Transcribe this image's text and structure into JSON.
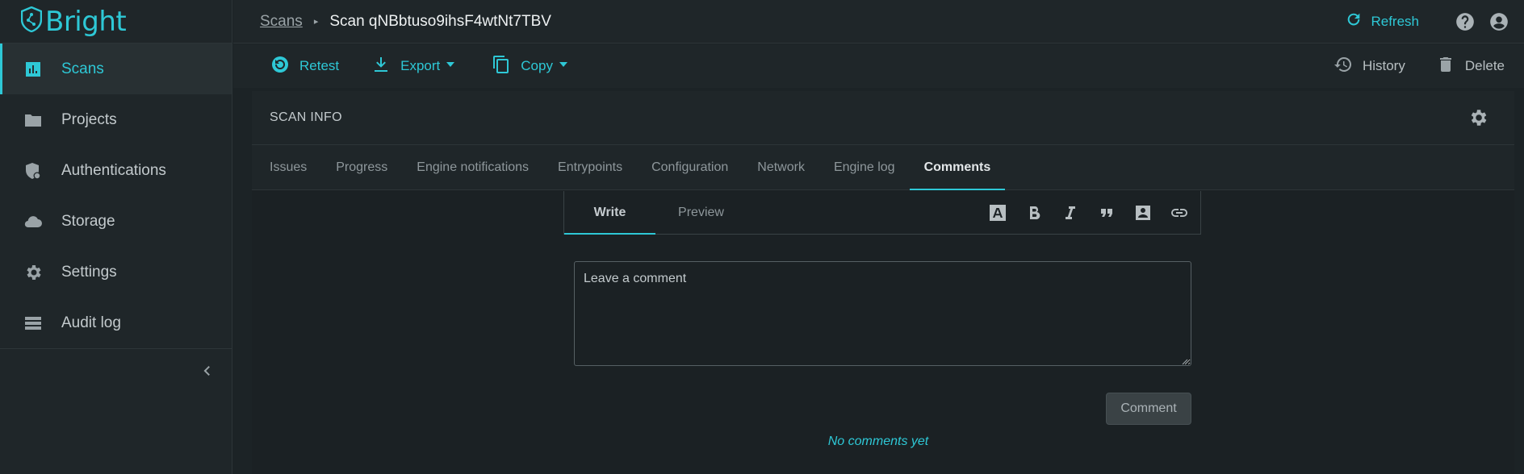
{
  "app": {
    "name": "Bright",
    "accent": "#2ec8d6"
  },
  "sidebar": {
    "items": [
      {
        "label": "Scans",
        "icon": "chart-icon",
        "active": true
      },
      {
        "label": "Projects",
        "icon": "folder-icon"
      },
      {
        "label": "Authentications",
        "icon": "shield-icon"
      },
      {
        "label": "Storage",
        "icon": "cloud-icon"
      },
      {
        "label": "Settings",
        "icon": "gear-icon"
      },
      {
        "label": "Audit log",
        "icon": "list-icon"
      }
    ],
    "collapse_icon": "chevron-left-icon"
  },
  "topbar": {
    "breadcrumb_root": "Scans",
    "breadcrumb_current": "Scan qNBbtuso9ihsF4wtNt7TBV",
    "refresh_label": "Refresh"
  },
  "toolbar": {
    "retest_label": "Retest",
    "export_label": "Export",
    "copy_label": "Copy",
    "history_label": "History",
    "delete_label": "Delete"
  },
  "card": {
    "title": "SCAN INFO",
    "tabs": [
      {
        "label": "Issues"
      },
      {
        "label": "Progress"
      },
      {
        "label": "Engine notifications"
      },
      {
        "label": "Entrypoints"
      },
      {
        "label": "Configuration"
      },
      {
        "label": "Network"
      },
      {
        "label": "Engine log"
      },
      {
        "label": "Comments",
        "active": true
      }
    ]
  },
  "editor": {
    "tabs": [
      {
        "label": "Write",
        "active": true
      },
      {
        "label": "Preview"
      }
    ],
    "format_icons": [
      "text-format-icon",
      "bold-icon",
      "italic-icon",
      "quote-icon",
      "mention-icon",
      "link-icon"
    ],
    "placeholder": "Leave a comment",
    "value": "",
    "submit_label": "Comment",
    "empty_text": "No comments yet"
  }
}
